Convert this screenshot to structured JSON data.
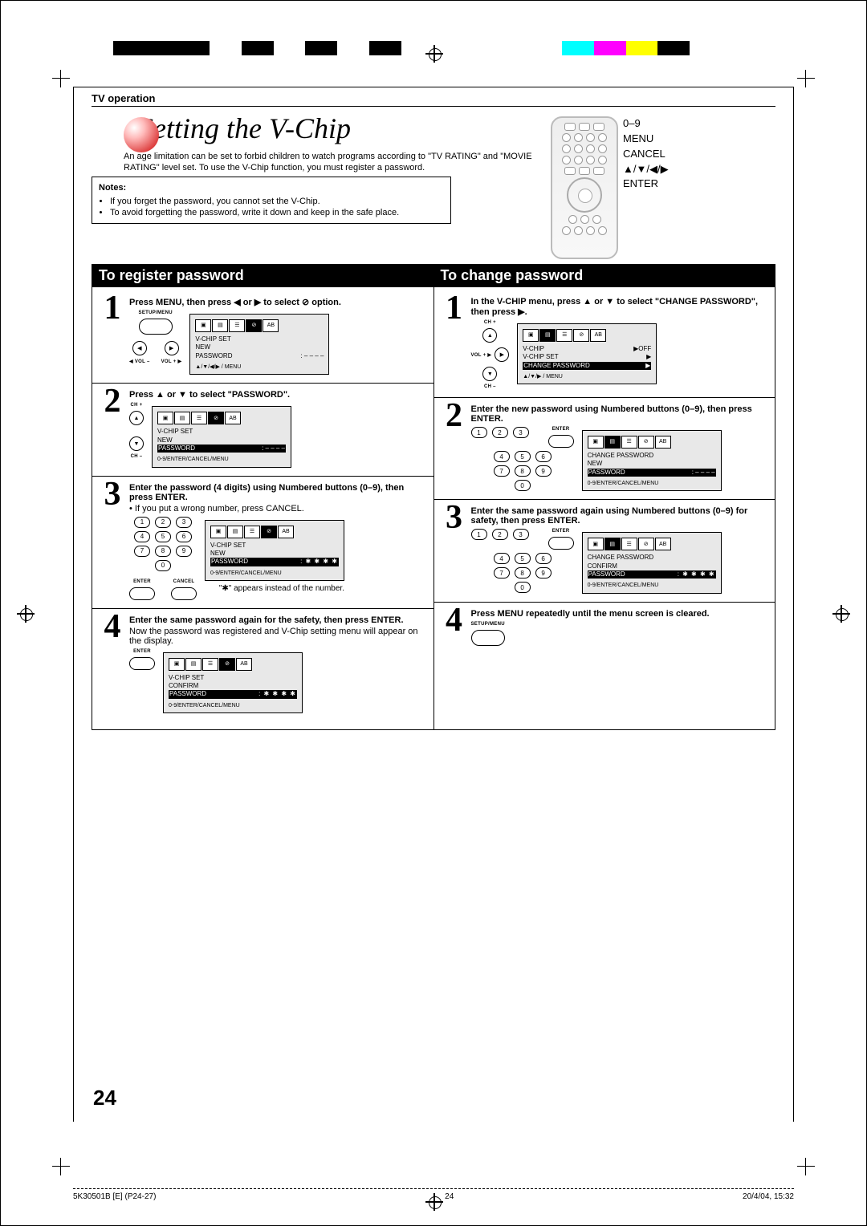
{
  "section": "TV operation",
  "title": "Setting the V-Chip",
  "intro": "An age limitation can be set to forbid children to watch programs according to \"TV RATING\" and \"MOVIE RATING\" level set. To use the V-Chip function, you must register a password.",
  "notes": {
    "heading": "Notes:",
    "items": [
      "If you forget the password, you cannot set the V-Chip.",
      "To avoid forgetting the password, write it down and keep in the safe place."
    ]
  },
  "remote_labels": {
    "digits": "0–9",
    "menu": "MENU",
    "cancel": "CANCEL",
    "arrows": "▲/▼/◀/▶",
    "enter": "ENTER"
  },
  "left": {
    "heading": "To register password",
    "steps": [
      {
        "n": "1",
        "lead": "Press MENU, then press ◀ or ▶ to select ⊘ option.",
        "ctl_setup": "SETUP/MENU",
        "ctl_volminus": "◀ VOL –",
        "ctl_volplus": "VOL + ▶",
        "osd": {
          "hl_tab": 3,
          "title": "V-CHIP SET",
          "rows": [
            [
              "NEW",
              ""
            ],
            [
              "PASSWORD",
              ": – – – –"
            ]
          ],
          "footer": "▲/▼/◀/▶ / MENU"
        }
      },
      {
        "n": "2",
        "lead": "Press ▲ or ▼ to select \"PASSWORD\".",
        "ctl_chplus": "CH +",
        "ctl_chminus": "CH –",
        "osd": {
          "hl_tab": 3,
          "title": "V-CHIP SET",
          "rows": [
            [
              "NEW",
              ""
            ]
          ],
          "hl_row": [
            "PASSWORD",
            ": – – – –"
          ],
          "footer": "0-9/ENTER/CANCEL/MENU"
        }
      },
      {
        "n": "3",
        "lead": "Enter the password (4 digits) using Numbered buttons (0–9), then press ENTER.",
        "body": "• If you put a wrong number, press CANCEL.",
        "note_after": "\"✱\" appears instead of the number.",
        "ctl_enter": "ENTER",
        "ctl_cancel": "CANCEL",
        "osd": {
          "hl_tab": 3,
          "title": "V-CHIP SET",
          "rows": [
            [
              "NEW",
              ""
            ]
          ],
          "hl_row": [
            "PASSWORD",
            ": ✱ ✱ ✱ ✱"
          ],
          "footer": "0-9/ENTER/CANCEL/MENU"
        }
      },
      {
        "n": "4",
        "lead": "Enter the same password again for the safety, then press ENTER.",
        "body": "Now the password was registered and V-Chip setting menu will appear on the display.",
        "ctl_enter": "ENTER",
        "osd": {
          "hl_tab": 3,
          "title": "V-CHIP SET",
          "rows": [
            [
              "CONFIRM",
              ""
            ]
          ],
          "hl_row": [
            "PASSWORD",
            ": ✱ ✱ ✱ ✱"
          ],
          "footer": "0-9/ENTER/CANCEL/MENU"
        }
      }
    ]
  },
  "right": {
    "heading": "To change password",
    "steps": [
      {
        "n": "1",
        "lead": "In the V-CHIP menu, press ▲ or ▼ to select \"CHANGE PASSWORD\", then press ▶.",
        "ctl_chplus": "CH +",
        "ctl_chminus": "CH –",
        "ctl_volplus": "VOL + ▶",
        "osd": {
          "hl_tab": 1,
          "rows": [
            [
              "V-CHIP",
              "▶OFF"
            ],
            [
              "V-CHIP SET",
              "▶"
            ]
          ],
          "hl_row": [
            "CHANGE PASSWORD",
            "▶"
          ],
          "footer": "▲/▼/▶ / MENU"
        }
      },
      {
        "n": "2",
        "lead": "Enter the new password using Numbered buttons (0–9), then press ENTER.",
        "ctl_enter": "ENTER",
        "osd": {
          "hl_tab": 1,
          "title": "CHANGE  PASSWORD",
          "rows": [
            [
              "NEW",
              ""
            ]
          ],
          "hl_row": [
            "PASSWORD",
            ": – – – –"
          ],
          "footer": "0-9/ENTER/CANCEL/MENU"
        }
      },
      {
        "n": "3",
        "lead": "Enter the same password again using Numbered buttons (0–9) for safety, then press ENTER.",
        "ctl_enter": "ENTER",
        "osd": {
          "hl_tab": 1,
          "title": "CHANGE  PASSWORD",
          "rows": [
            [
              "CONFIRM",
              ""
            ]
          ],
          "hl_row": [
            "PASSWORD",
            ": ✱ ✱ ✱ ✱"
          ],
          "footer": "0-9/ENTER/CANCEL/MENU"
        }
      },
      {
        "n": "4",
        "lead": "Press MENU repeatedly until the menu screen is cleared.",
        "ctl_setup": "SETUP/MENU"
      }
    ]
  },
  "page_number": "24",
  "print_footer": {
    "left": "5K30501B [E] (P24-27)",
    "center": "24",
    "right": "20/4/04, 15:32"
  }
}
